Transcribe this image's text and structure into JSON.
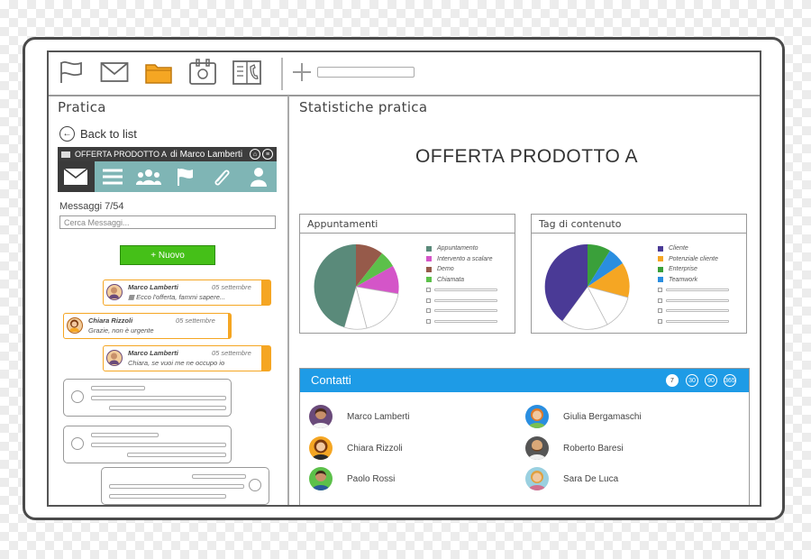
{
  "toolbar": {
    "icons": [
      "flag-icon",
      "mail-icon",
      "folder-icon",
      "calendar-icon",
      "phone-book-icon",
      "plus-icon"
    ],
    "active_color": "#f5a623"
  },
  "left": {
    "title": "Pratica",
    "back_label": "Back to list",
    "offer_header": {
      "prefix": "OFFERTA PRODOTTO A",
      "suffix": "di Marco Lamberti"
    },
    "tabs": [
      "mail-icon",
      "list-icon",
      "users-icon",
      "flag-icon",
      "paperclip-icon",
      "user-icon"
    ],
    "tab_color": "#7fb5b5",
    "message_count": "Messaggi 7/54",
    "search_placeholder": "Cerca Messaggi...",
    "new_button": "+ Nuovo",
    "messages": [
      {
        "author": "Marco Lamberti",
        "date": "05 settembre",
        "text": "Ecco l'offerta, fammi sapere..."
      },
      {
        "author": "Chiara Rizzoli",
        "date": "05 settembre",
        "text": "Grazie, non è urgente"
      },
      {
        "author": "Marco Lamberti",
        "date": "05 settembre",
        "text": "Chiara, se vuoi me ne occupo io"
      }
    ]
  },
  "right": {
    "title": "Statistiche pratica",
    "heading": "OFFERTA PRODOTTO A",
    "appointments": {
      "title": "Appuntamenti",
      "legend": [
        {
          "label": "Appuntamento",
          "color": "#5a8a7a"
        },
        {
          "label": "Intervento a scalare",
          "color": "#d455c8"
        },
        {
          "label": "Demo",
          "color": "#965a4a"
        },
        {
          "label": "Chiamata",
          "color": "#5cc04a"
        }
      ]
    },
    "tags": {
      "title": "Tag di contenuto",
      "legend": [
        {
          "label": "Cliente",
          "color": "#4a3a96"
        },
        {
          "label": "Potenziale cliente",
          "color": "#f5a623"
        },
        {
          "label": "Enterprise",
          "color": "#3aa03a"
        },
        {
          "label": "Teamwork",
          "color": "#2a8ee0"
        }
      ]
    },
    "contacts": {
      "title": "Contatti",
      "filters": [
        "7",
        "30",
        "90",
        "365"
      ],
      "people": [
        "Marco Lamberti",
        "Giulia Bergamaschi",
        "Chiara Rizzoli",
        "Roberto Baresi",
        "Paolo Rossi",
        "Sara De Luca"
      ]
    }
  }
}
